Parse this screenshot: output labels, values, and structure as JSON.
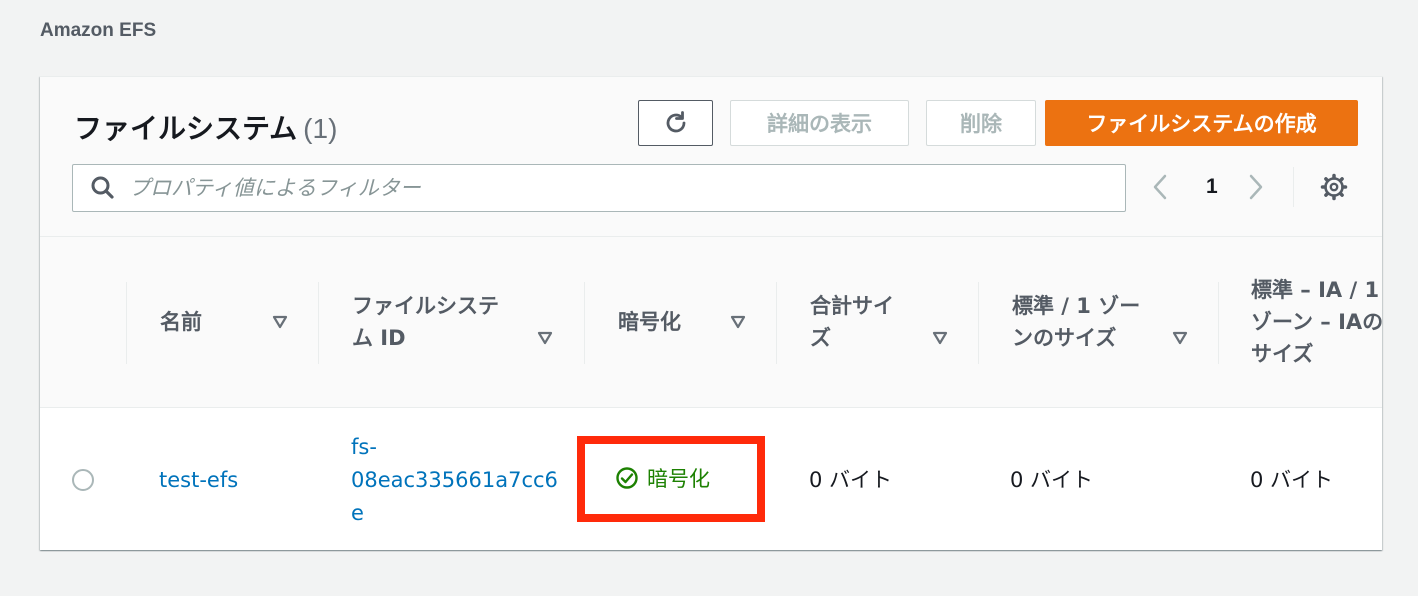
{
  "breadcrumb": "Amazon EFS",
  "panel": {
    "title": "ファイルシステム",
    "count": "(1)",
    "buttons": {
      "detail": "詳細の表示",
      "delete": "削除",
      "create": "ファイルシステムの作成"
    },
    "search": {
      "placeholder": "プロパティ値によるフィルター",
      "value": ""
    },
    "pagination": {
      "current_page": "1"
    },
    "icons": [
      "refresh-icon",
      "search-icon",
      "chevron-left-icon",
      "chevron-right-icon",
      "gear-icon",
      "sort-down-icon",
      "check-circle-icon"
    ]
  },
  "table": {
    "columns": [
      {
        "line1": "名前",
        "line2": "",
        "line3": ""
      },
      {
        "line1": "ファイルシステ",
        "line2": "ム ID",
        "line3": ""
      },
      {
        "line1": "暗号化",
        "line2": "",
        "line3": ""
      },
      {
        "line1": "合計サイ",
        "line2": "ズ",
        "line3": ""
      },
      {
        "line1": "標準 / 1 ゾー",
        "line2": "ンのサイズ",
        "line3": ""
      },
      {
        "line1": "標準 – IA / 1",
        "line2": "ゾーン – IAの",
        "line3": "サイズ"
      }
    ],
    "rows": [
      {
        "name": "test-efs",
        "id_line1": "fs-",
        "id_line2": "08eac335661a7cc6",
        "id_line3": "e",
        "encryption": "暗号化",
        "total_size": "0 バイト",
        "standard_size": "0 バイト",
        "ia_size": "0 バイト"
      }
    ]
  },
  "colors": {
    "primary": "#ec7211",
    "link": "#0073bb",
    "success": "#1d8102",
    "highlight": "#ff2a0a"
  }
}
